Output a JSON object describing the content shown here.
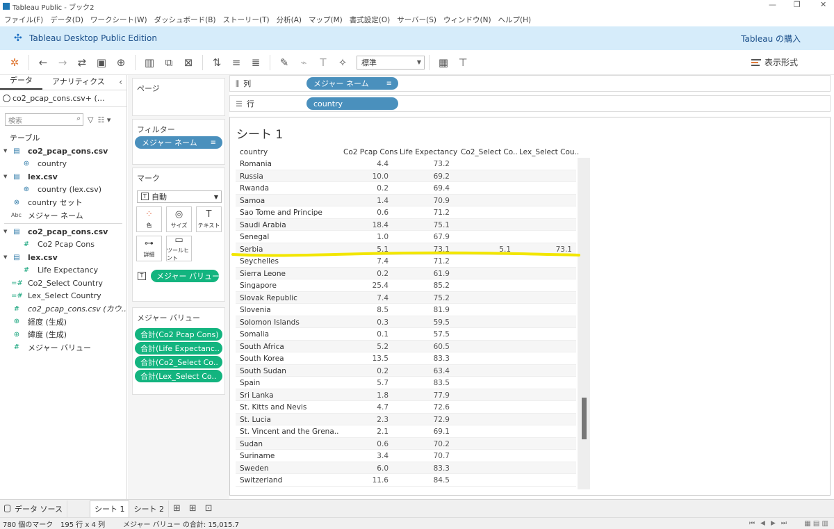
{
  "window": {
    "title": "Tableau Public - ブック2",
    "controls": [
      "—",
      "❐",
      "✕"
    ]
  },
  "menu": [
    "ファイル(F)",
    "データ(D)",
    "ワークシート(W)",
    "ダッシュボード(B)",
    "ストーリー(T)",
    "分析(A)",
    "マップ(M)",
    "書式設定(O)",
    "サーバー(S)",
    "ウィンドウ(N)",
    "ヘルプ(H)"
  ],
  "banner": {
    "edition": "Tableau Desktop Public Edition",
    "buy": "Tableau の購入"
  },
  "toolbar": {
    "fit_select": "標準",
    "show_me": "表示形式"
  },
  "data_pane": {
    "tabs": [
      "データ",
      "アナリティクス"
    ],
    "source": "co2_pcap_cons.csv+ (…",
    "search_placeholder": "検索",
    "section": "テーブル",
    "fields": [
      {
        "label": "co2_pcap_cons.csv",
        "kind": "table"
      },
      {
        "label": "country",
        "kind": "geo"
      },
      {
        "label": "lex.csv",
        "kind": "table"
      },
      {
        "label": "country (lex.csv)",
        "kind": "geo"
      },
      {
        "label": "country セット",
        "kind": "set"
      },
      {
        "label": "メジャー ネーム",
        "kind": "abc"
      },
      {
        "label": "co2_pcap_cons.csv",
        "kind": "table"
      },
      {
        "label": "Co2 Pcap Cons",
        "kind": "measure"
      },
      {
        "label": "lex.csv",
        "kind": "table"
      },
      {
        "label": "Life Expectancy",
        "kind": "measure"
      },
      {
        "label": "Co2_Select Country",
        "kind": "calc"
      },
      {
        "label": "Lex_Select Country",
        "kind": "calc"
      },
      {
        "label": "co2_pcap_cons.csv (カウ…",
        "kind": "count"
      },
      {
        "label": "経度 (生成)",
        "kind": "geo"
      },
      {
        "label": "緯度 (生成)",
        "kind": "geo"
      },
      {
        "label": "メジャー バリュー",
        "kind": "measure"
      }
    ]
  },
  "shelves": {
    "pages_title": "ページ",
    "filters_title": "フィルター",
    "filter_pill": "メジャー ネーム",
    "marks_title": "マーク",
    "marks_type": "自動",
    "mark_buttons": [
      "色",
      "サイズ",
      "テキスト",
      "詳細",
      "ツールヒント"
    ],
    "marks_pill": "メジャー バリュー",
    "measure_values_title": "メジャー バリュー",
    "measure_values": [
      "合計(Co2 Pcap Cons)",
      "合計(Life Expectanc..",
      "合計(Co2_Select Co..",
      "合計(Lex_Select Co.."
    ],
    "columns_label": "列",
    "columns_pill": "メジャー ネーム",
    "rows_label": "行",
    "rows_pill": "country"
  },
  "sheet": {
    "title": "シート 1",
    "headers": [
      "country",
      "Co2 Pcap Cons",
      "Life Expectancy",
      "Co2_Select Co..",
      "Lex_Select Cou.."
    ],
    "rows": [
      [
        "Romania",
        "4.4",
        "73.2",
        "",
        ""
      ],
      [
        "Russia",
        "10.0",
        "69.2",
        "",
        ""
      ],
      [
        "Rwanda",
        "0.2",
        "69.4",
        "",
        ""
      ],
      [
        "Samoa",
        "1.4",
        "70.9",
        "",
        ""
      ],
      [
        "Sao Tome and Principe",
        "0.6",
        "71.2",
        "",
        ""
      ],
      [
        "Saudi Arabia",
        "18.4",
        "75.1",
        "",
        ""
      ],
      [
        "Senegal",
        "1.0",
        "67.9",
        "",
        ""
      ],
      [
        "Serbia",
        "5.1",
        "73.1",
        "5.1",
        "73.1"
      ],
      [
        "Seychelles",
        "7.4",
        "71.2",
        "",
        ""
      ],
      [
        "Sierra Leone",
        "0.2",
        "61.9",
        "",
        ""
      ],
      [
        "Singapore",
        "25.4",
        "85.2",
        "",
        ""
      ],
      [
        "Slovak Republic",
        "7.4",
        "75.2",
        "",
        ""
      ],
      [
        "Slovenia",
        "8.5",
        "81.9",
        "",
        ""
      ],
      [
        "Solomon Islands",
        "0.3",
        "59.5",
        "",
        ""
      ],
      [
        "Somalia",
        "0.1",
        "57.5",
        "",
        ""
      ],
      [
        "South Africa",
        "5.2",
        "60.5",
        "",
        ""
      ],
      [
        "South Korea",
        "13.5",
        "83.3",
        "",
        ""
      ],
      [
        "South Sudan",
        "0.2",
        "63.4",
        "",
        ""
      ],
      [
        "Spain",
        "5.7",
        "83.5",
        "",
        ""
      ],
      [
        "Sri Lanka",
        "1.8",
        "77.9",
        "",
        ""
      ],
      [
        "St. Kitts and Nevis",
        "4.7",
        "72.6",
        "",
        ""
      ],
      [
        "St. Lucia",
        "2.3",
        "72.9",
        "",
        ""
      ],
      [
        "St. Vincent and the Grena..",
        "2.1",
        "69.1",
        "",
        ""
      ],
      [
        "Sudan",
        "0.6",
        "70.2",
        "",
        ""
      ],
      [
        "Suriname",
        "3.4",
        "70.7",
        "",
        ""
      ],
      [
        "Sweden",
        "6.0",
        "83.3",
        "",
        ""
      ],
      [
        "Switzerland",
        "11.6",
        "84.5",
        "",
        ""
      ]
    ],
    "highlight_color": "#f2e600"
  },
  "tabs": {
    "data_source": "データ ソース",
    "sheets": [
      "シート 1",
      "シート 2"
    ]
  },
  "status": {
    "marks": "780 個のマーク",
    "dims": "195 行 x 4 列",
    "sum": "メジャー バリュー の合計: 15,015.7"
  },
  "colors": {
    "accent_blue": "#4a90bd",
    "accent_green": "#13b47f",
    "banner": "#d6ecfa"
  }
}
